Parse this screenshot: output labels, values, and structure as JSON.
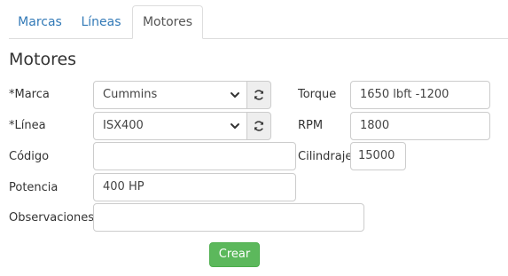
{
  "tabs": [
    {
      "label": "Marcas"
    },
    {
      "label": "Líneas"
    },
    {
      "label": "Motores"
    }
  ],
  "page_title": "Motores",
  "form": {
    "marca": {
      "label": "*Marca",
      "value": "Cummins"
    },
    "linea": {
      "label": "*Línea",
      "value": "ISX400"
    },
    "codigo": {
      "label": "Código",
      "value": ""
    },
    "potencia": {
      "label": "Potencia",
      "value": "400 HP"
    },
    "observaciones": {
      "label": "Observaciones",
      "value": ""
    },
    "torque": {
      "label": "Torque",
      "value": "1650 lbft -1200"
    },
    "rpm": {
      "label": "RPM",
      "value": "1800"
    },
    "cilindraje": {
      "label": "Cilindraje",
      "value": "15000"
    }
  },
  "actions": {
    "create_label": "Crear"
  },
  "icons": {
    "refresh": "refresh-icon",
    "chevron": "chevron-down-icon"
  },
  "colors": {
    "link": "#337ab7",
    "success": "#5cb85c"
  }
}
